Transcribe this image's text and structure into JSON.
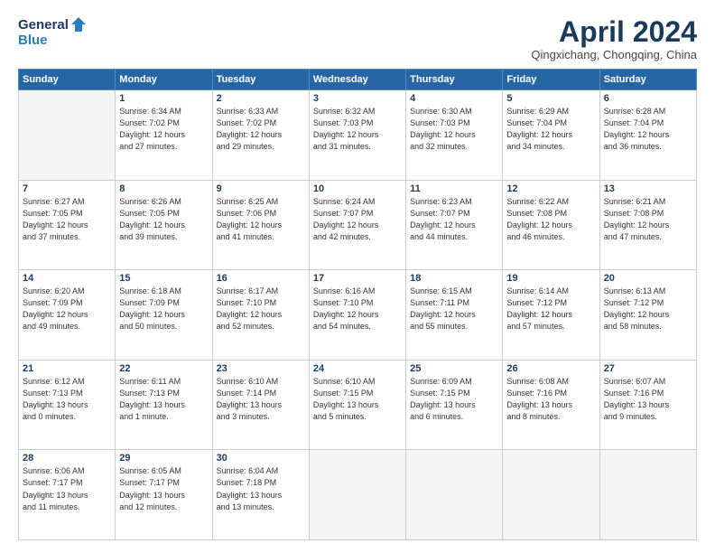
{
  "header": {
    "logo_general": "General",
    "logo_blue": "Blue",
    "title": "April 2024",
    "location": "Qingxichang, Chongqing, China"
  },
  "days_of_week": [
    "Sunday",
    "Monday",
    "Tuesday",
    "Wednesday",
    "Thursday",
    "Friday",
    "Saturday"
  ],
  "weeks": [
    [
      {
        "day": "",
        "info": ""
      },
      {
        "day": "1",
        "info": "Sunrise: 6:34 AM\nSunset: 7:02 PM\nDaylight: 12 hours\nand 27 minutes."
      },
      {
        "day": "2",
        "info": "Sunrise: 6:33 AM\nSunset: 7:02 PM\nDaylight: 12 hours\nand 29 minutes."
      },
      {
        "day": "3",
        "info": "Sunrise: 6:32 AM\nSunset: 7:03 PM\nDaylight: 12 hours\nand 31 minutes."
      },
      {
        "day": "4",
        "info": "Sunrise: 6:30 AM\nSunset: 7:03 PM\nDaylight: 12 hours\nand 32 minutes."
      },
      {
        "day": "5",
        "info": "Sunrise: 6:29 AM\nSunset: 7:04 PM\nDaylight: 12 hours\nand 34 minutes."
      },
      {
        "day": "6",
        "info": "Sunrise: 6:28 AM\nSunset: 7:04 PM\nDaylight: 12 hours\nand 36 minutes."
      }
    ],
    [
      {
        "day": "7",
        "info": "Sunrise: 6:27 AM\nSunset: 7:05 PM\nDaylight: 12 hours\nand 37 minutes."
      },
      {
        "day": "8",
        "info": "Sunrise: 6:26 AM\nSunset: 7:05 PM\nDaylight: 12 hours\nand 39 minutes."
      },
      {
        "day": "9",
        "info": "Sunrise: 6:25 AM\nSunset: 7:06 PM\nDaylight: 12 hours\nand 41 minutes."
      },
      {
        "day": "10",
        "info": "Sunrise: 6:24 AM\nSunset: 7:07 PM\nDaylight: 12 hours\nand 42 minutes."
      },
      {
        "day": "11",
        "info": "Sunrise: 6:23 AM\nSunset: 7:07 PM\nDaylight: 12 hours\nand 44 minutes."
      },
      {
        "day": "12",
        "info": "Sunrise: 6:22 AM\nSunset: 7:08 PM\nDaylight: 12 hours\nand 46 minutes."
      },
      {
        "day": "13",
        "info": "Sunrise: 6:21 AM\nSunset: 7:08 PM\nDaylight: 12 hours\nand 47 minutes."
      }
    ],
    [
      {
        "day": "14",
        "info": "Sunrise: 6:20 AM\nSunset: 7:09 PM\nDaylight: 12 hours\nand 49 minutes."
      },
      {
        "day": "15",
        "info": "Sunrise: 6:18 AM\nSunset: 7:09 PM\nDaylight: 12 hours\nand 50 minutes."
      },
      {
        "day": "16",
        "info": "Sunrise: 6:17 AM\nSunset: 7:10 PM\nDaylight: 12 hours\nand 52 minutes."
      },
      {
        "day": "17",
        "info": "Sunrise: 6:16 AM\nSunset: 7:10 PM\nDaylight: 12 hours\nand 54 minutes."
      },
      {
        "day": "18",
        "info": "Sunrise: 6:15 AM\nSunset: 7:11 PM\nDaylight: 12 hours\nand 55 minutes."
      },
      {
        "day": "19",
        "info": "Sunrise: 6:14 AM\nSunset: 7:12 PM\nDaylight: 12 hours\nand 57 minutes."
      },
      {
        "day": "20",
        "info": "Sunrise: 6:13 AM\nSunset: 7:12 PM\nDaylight: 12 hours\nand 58 minutes."
      }
    ],
    [
      {
        "day": "21",
        "info": "Sunrise: 6:12 AM\nSunset: 7:13 PM\nDaylight: 13 hours\nand 0 minutes."
      },
      {
        "day": "22",
        "info": "Sunrise: 6:11 AM\nSunset: 7:13 PM\nDaylight: 13 hours\nand 1 minute."
      },
      {
        "day": "23",
        "info": "Sunrise: 6:10 AM\nSunset: 7:14 PM\nDaylight: 13 hours\nand 3 minutes."
      },
      {
        "day": "24",
        "info": "Sunrise: 6:10 AM\nSunset: 7:15 PM\nDaylight: 13 hours\nand 5 minutes."
      },
      {
        "day": "25",
        "info": "Sunrise: 6:09 AM\nSunset: 7:15 PM\nDaylight: 13 hours\nand 6 minutes."
      },
      {
        "day": "26",
        "info": "Sunrise: 6:08 AM\nSunset: 7:16 PM\nDaylight: 13 hours\nand 8 minutes."
      },
      {
        "day": "27",
        "info": "Sunrise: 6:07 AM\nSunset: 7:16 PM\nDaylight: 13 hours\nand 9 minutes."
      }
    ],
    [
      {
        "day": "28",
        "info": "Sunrise: 6:06 AM\nSunset: 7:17 PM\nDaylight: 13 hours\nand 11 minutes."
      },
      {
        "day": "29",
        "info": "Sunrise: 6:05 AM\nSunset: 7:17 PM\nDaylight: 13 hours\nand 12 minutes."
      },
      {
        "day": "30",
        "info": "Sunrise: 6:04 AM\nSunset: 7:18 PM\nDaylight: 13 hours\nand 13 minutes."
      },
      {
        "day": "",
        "info": ""
      },
      {
        "day": "",
        "info": ""
      },
      {
        "day": "",
        "info": ""
      },
      {
        "day": "",
        "info": ""
      }
    ]
  ]
}
